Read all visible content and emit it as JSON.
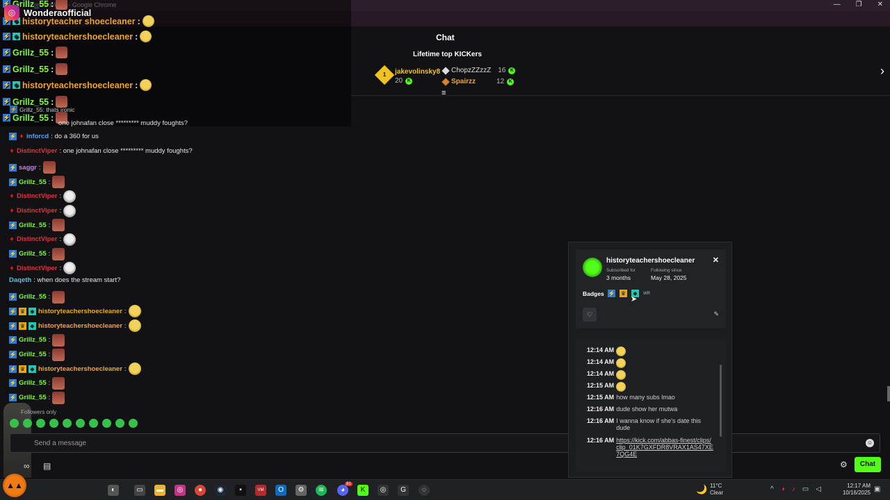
{
  "window": {
    "title": "Wondera/chat - Google Chrome",
    "min_label": "—",
    "max_label": "❐",
    "close_label": "✕"
  },
  "overlay": {
    "channel_name": "Wonderaofficial",
    "messages": [
      {
        "user": "Grillz_55",
        "colon": ":",
        "color": "green"
      },
      {
        "user": "historyteacher shoecleaner",
        "colon": ":",
        "color": "orange"
      },
      {
        "user": "historyteachershoecleaner",
        "colon": ":",
        "color": "orange"
      },
      {
        "user": "Grillz_55",
        "colon": ":",
        "color": "green"
      },
      {
        "user": "Grillz_55",
        "colon": ":",
        "color": "green"
      },
      {
        "user": "historyteachershoecleaner",
        "colon": ":",
        "color": "orange"
      },
      {
        "user": "Grillz_55",
        "colon": ":",
        "color": "green"
      },
      {
        "user": "Grillz_55",
        "colon": ":",
        "color": "green"
      }
    ],
    "peek_text": "Grillz_55: thats ironic",
    "peek_text2": "one johnafan close ********* muddy foughts?"
  },
  "header": {
    "chat_title": "Chat",
    "lifetime_title": "Lifetime top KICKers",
    "first": {
      "rank": "1",
      "name": "jakevolinsky8",
      "amount": "20"
    },
    "others": [
      {
        "name": "ChopzZZzzZ",
        "amount": "16"
      },
      {
        "name": "Spairzz",
        "amount": "12"
      }
    ]
  },
  "chat": {
    "messages": [
      {
        "badges": [
          "mod",
          "red"
        ],
        "user": "inforcd",
        "color": "blue",
        "text": ": do a 360 for us"
      },
      {
        "badges": [
          "red"
        ],
        "user": "DistinctViper",
        "color": "red",
        "text": ": one johnafan close ********* muddy foughts?"
      },
      {
        "badges": [
          "mod"
        ],
        "user": "saggr",
        "color": "purple",
        "text": ":",
        "emote": "face"
      },
      {
        "badges": [
          "mod"
        ],
        "user": "Grillz_55",
        "color": "green",
        "text": ":",
        "emote": "face"
      },
      {
        "badges": [
          "red"
        ],
        "user": "DistinctViper",
        "color": "red",
        "text": ":",
        "emote": "skull"
      },
      {
        "badges": [
          "red"
        ],
        "user": "DistinctViper",
        "color": "red",
        "text": ":",
        "emote": "skull"
      },
      {
        "badges": [
          "mod"
        ],
        "user": "Grillz_55",
        "color": "green",
        "text": ":",
        "emote": "face"
      },
      {
        "badges": [
          "red"
        ],
        "user": "DistinctViper",
        "color": "red",
        "text": ":",
        "emote": "skull"
      },
      {
        "badges": [
          "mod"
        ],
        "user": "Grillz_55",
        "color": "green",
        "text": ":",
        "emote": "face"
      },
      {
        "badges": [
          "red"
        ],
        "user": "DistinctViper",
        "color": "red",
        "text": ":",
        "emote": "skull"
      },
      {
        "badges": [],
        "user": "Daqeth",
        "color": "cyan",
        "text": ": when does the stream start?"
      },
      {
        "badges": [
          "mod"
        ],
        "user": "Grillz_55",
        "color": "green",
        "text": ":",
        "emote": "face"
      },
      {
        "badges": [
          "mod",
          "crown",
          "teal"
        ],
        "user": "historyteachershoecleaner",
        "color": "orange",
        "text": ":",
        "emote": "lol"
      },
      {
        "badges": [
          "mod",
          "crown",
          "teal"
        ],
        "user": "historyteachershoecleaner",
        "color": "orange",
        "text": ":",
        "emote": "lol"
      },
      {
        "badges": [
          "mod"
        ],
        "user": "Grillz_55",
        "color": "green",
        "text": ":",
        "emote": "face"
      },
      {
        "badges": [
          "mod"
        ],
        "user": "Grillz_55",
        "color": "green",
        "text": ":",
        "emote": "face"
      },
      {
        "badges": [
          "mod",
          "crown",
          "teal"
        ],
        "user": "historyteachershoecleaner",
        "color": "orange",
        "text": ":",
        "emote": "lol"
      },
      {
        "badges": [
          "mod"
        ],
        "user": "Grillz_55",
        "color": "green",
        "text": ":",
        "emote": "face"
      },
      {
        "badges": [
          "mod"
        ],
        "user": "Grillz_55",
        "color": "green",
        "text": ":",
        "emote": "face"
      }
    ],
    "followers_only": "Followers only",
    "input_placeholder": "Send a message",
    "send_label": "Chat"
  },
  "card": {
    "username": "historyteachershoecleaner",
    "subscribed_label": "Subscribed for",
    "subscribed_value": "3 months",
    "following_label": "Following since",
    "following_value": "May 28, 2025",
    "badges_label": "Badges",
    "wr_label": "WR",
    "history": [
      {
        "time": "12:14 AM",
        "emote": true,
        "text": ""
      },
      {
        "time": "12:14 AM",
        "emote": true,
        "text": ""
      },
      {
        "time": "12:14 AM",
        "emote": true,
        "text": ""
      },
      {
        "time": "12:15 AM",
        "emote": true,
        "text": ""
      },
      {
        "time": "12:15 AM",
        "emote": false,
        "text": "how many subs lmao"
      },
      {
        "time": "12:16 AM",
        "emote": false,
        "text": "dude show her mutwa"
      },
      {
        "time": "12:16 AM",
        "emote": false,
        "text": "I wanna know if she's date this dude"
      },
      {
        "time": "12:16 AM",
        "emote": false,
        "text": "https://kick.com/abbas-finest/clips/clip_01K7GXFDR8VRAX1AS47XE7QG4E",
        "link": true
      }
    ]
  },
  "taskbar": {
    "temperature": "11°C",
    "weather": "Clear",
    "time": "12:17 AM",
    "date": "10/16/2025",
    "discord_badge": "91"
  },
  "colors": {
    "kick_green": "#53fc18",
    "bg": "#121214"
  }
}
